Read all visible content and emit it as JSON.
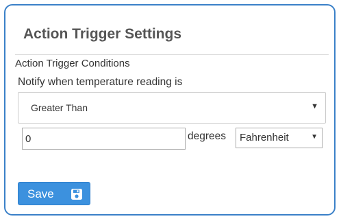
{
  "panel": {
    "title": "Action Trigger Settings"
  },
  "section": {
    "label": "Action Trigger Conditions"
  },
  "condition": {
    "prompt": "Notify when temperature reading is",
    "comparator": "Greater Than",
    "threshold_value": "0",
    "units_label": "degrees",
    "unit": "Fahrenheit"
  },
  "actions": {
    "save_label": "Save"
  },
  "icons": {
    "dropdown_caret": "▼",
    "save_icon": "floppy-disk-icon"
  },
  "colors": {
    "accent": "#3c91de",
    "panel_border": "#3a80c8",
    "title_text": "#555555"
  }
}
